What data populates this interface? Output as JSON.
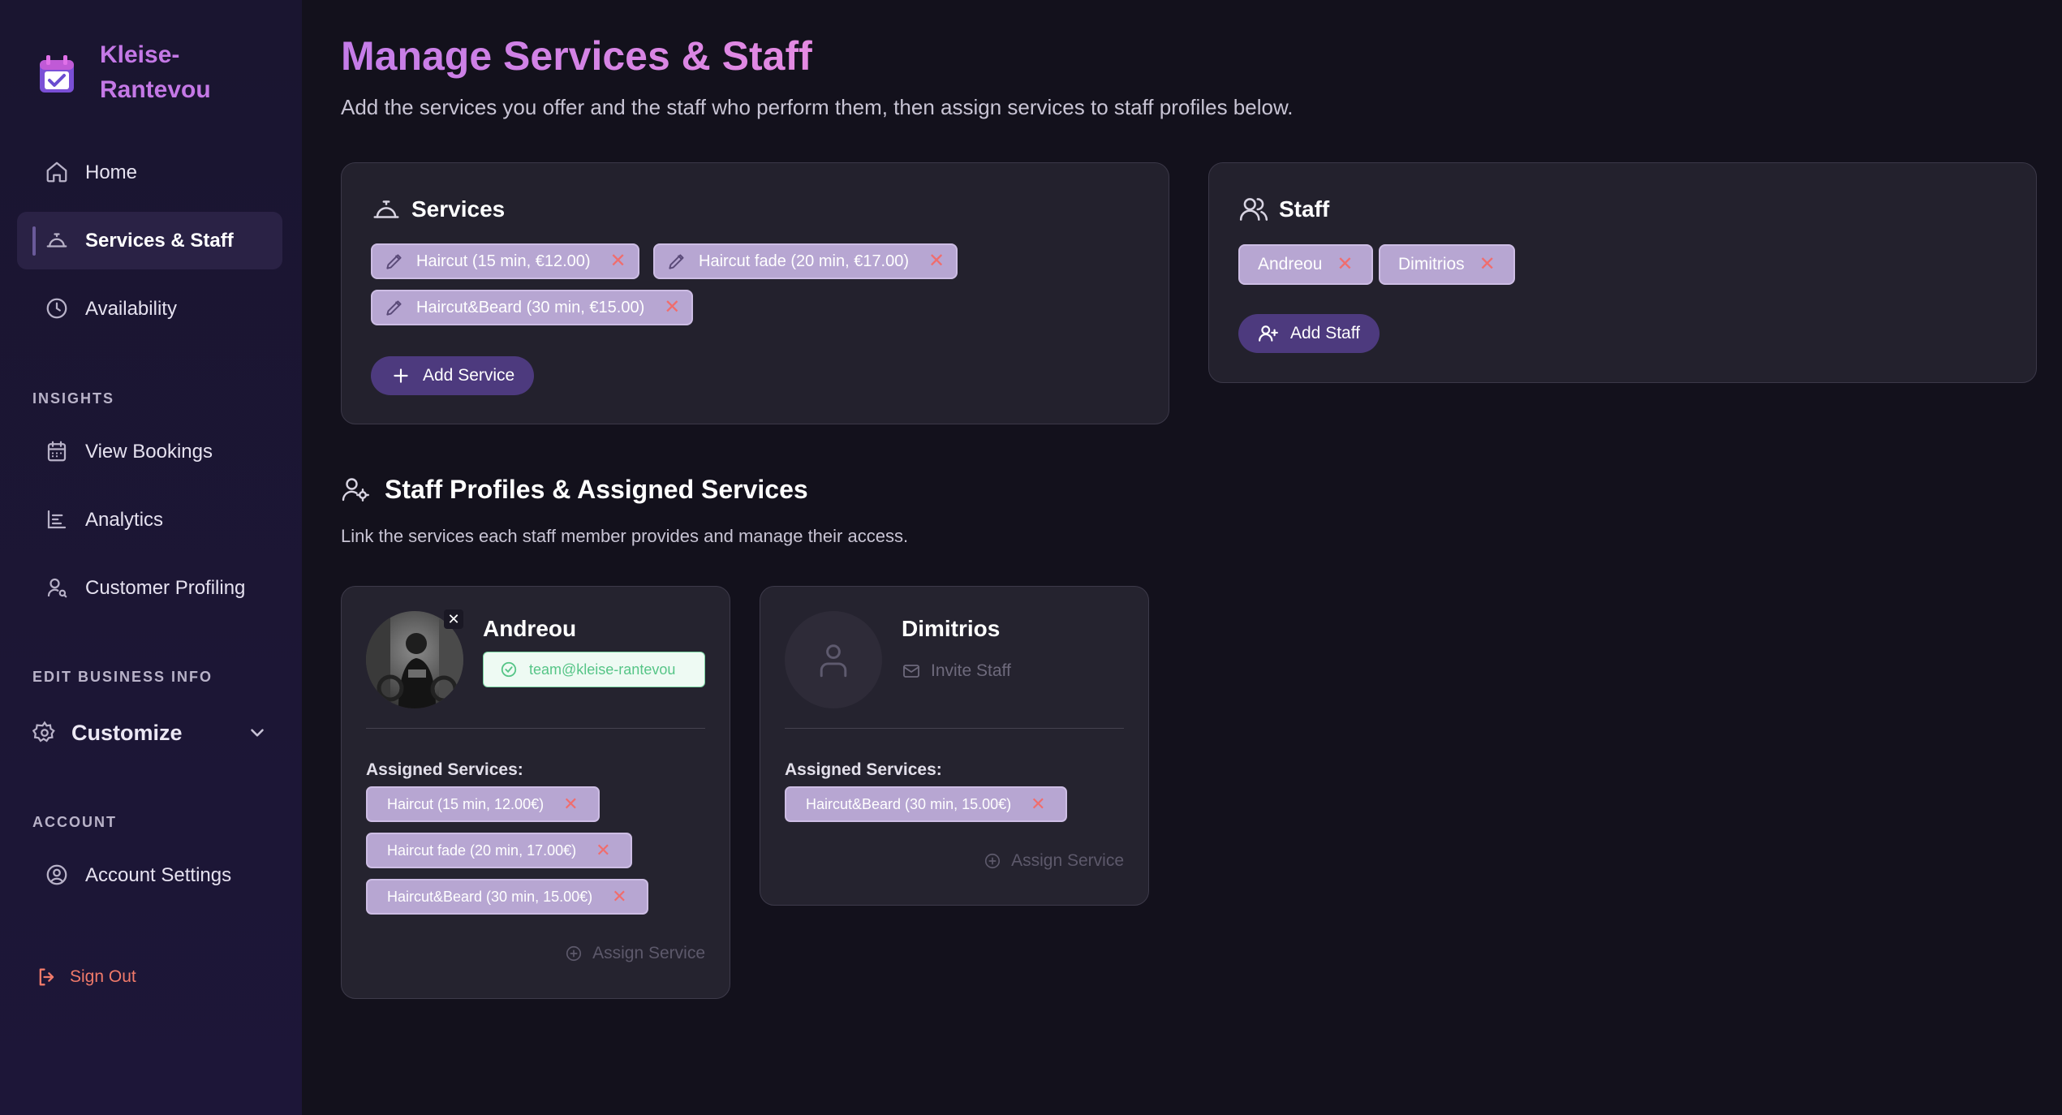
{
  "brand": {
    "name": "Kleise-Rantevou"
  },
  "nav": {
    "home": "Home",
    "services_staff": "Services & Staff",
    "availability": "Availability",
    "insights_title": "INSIGHTS",
    "view_bookings": "View Bookings",
    "analytics": "Analytics",
    "customer_profiling": "Customer Profiling",
    "edit_title": "EDIT BUSINESS INFO",
    "customize": "Customize",
    "account_title": "ACCOUNT",
    "account_settings": "Account Settings",
    "sign_out": "Sign Out"
  },
  "page": {
    "title": "Manage Services & Staff",
    "subtitle": "Add the services you offer and the staff who perform them, then assign services to staff profiles below."
  },
  "services": {
    "title": "Services",
    "items": [
      "Haircut (15 min, €12.00)",
      "Haircut fade (20 min, €17.00)",
      "Haircut&Beard (30 min, €15.00)"
    ],
    "add_label": "Add Service"
  },
  "staff": {
    "title": "Staff",
    "items": [
      "Andreou",
      "Dimitrios"
    ],
    "add_label": "Add Staff"
  },
  "profiles": {
    "title": "Staff Profiles & Assigned Services",
    "subtitle": "Link the services each staff member provides and manage their access.",
    "assigned_label": "Assigned Services:",
    "assign_label": "Assign Service",
    "andreou": {
      "name": "Andreou",
      "email": "team@kleise-rantevou",
      "services": [
        "Haircut (15 min, 12.00€)",
        "Haircut fade (20 min, 17.00€)",
        "Haircut&Beard (30 min, 15.00€)"
      ]
    },
    "dimitrios": {
      "name": "Dimitrios",
      "invite_label": "Invite Staff",
      "services": [
        "Haircut&Beard (30 min, 15.00€)"
      ]
    }
  },
  "colors": {
    "accent": "#c478e6",
    "chip": "#b7a6d2",
    "button": "#4d3a7e",
    "remove": "#f06d6d",
    "success": "#56c587"
  }
}
